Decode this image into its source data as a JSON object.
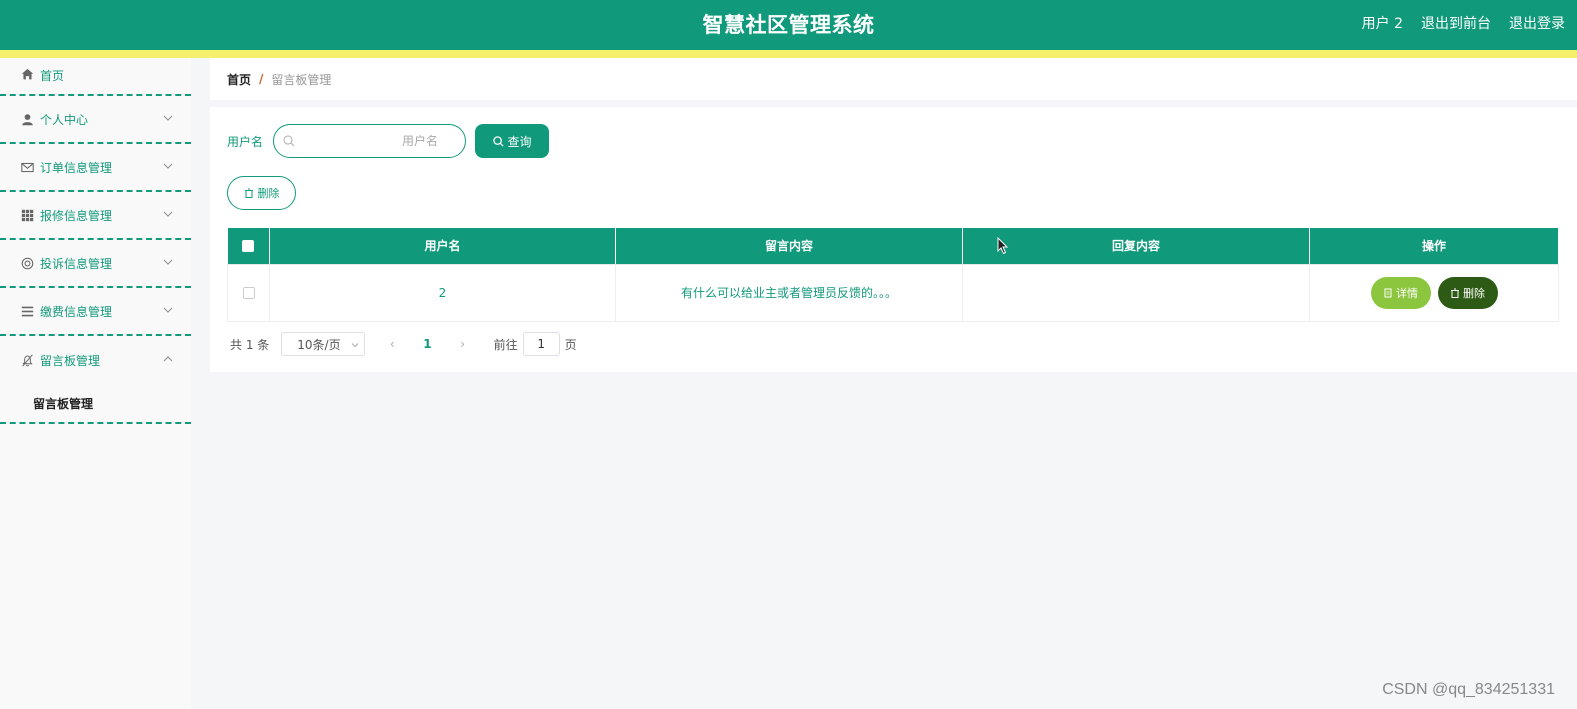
{
  "header": {
    "title": "智慧社区管理系统",
    "user": "用户 2",
    "to_front": "退出到前台",
    "logout": "退出登录",
    "bg_color": "#109a7b",
    "stripe_color": "#f4f06c"
  },
  "sidebar": {
    "items": [
      {
        "label": "首页",
        "icon": "home-icon"
      },
      {
        "label": "个人中心",
        "icon": "user-icon"
      },
      {
        "label": "订单信息管理",
        "icon": "mail-icon"
      },
      {
        "label": "报修信息管理",
        "icon": "grid-icon"
      },
      {
        "label": "投诉信息管理",
        "icon": "lifebuoy-icon"
      },
      {
        "label": "缴费信息管理",
        "icon": "menu-icon"
      },
      {
        "label": "留言板管理",
        "icon": "bell-off-icon"
      }
    ],
    "sub_item": "留言板管理"
  },
  "breadcrumb": {
    "home": "首页",
    "sep": "/",
    "current": "留言板管理"
  },
  "search": {
    "label": "用户名",
    "placeholder": "用户名",
    "query_button": "查询"
  },
  "actions": {
    "delete_button": "删除"
  },
  "table": {
    "headers": [
      "用户名",
      "留言内容",
      "回复内容",
      "操作"
    ],
    "rows": [
      {
        "username": "2",
        "content": "有什么可以给业主或者管理员反馈的。。。",
        "reply": "",
        "detail": "详情",
        "delete": "删除"
      }
    ]
  },
  "pagination": {
    "total": "共 1 条",
    "page_size": "10条/页",
    "prev": "‹",
    "current_page": "1",
    "next": "›",
    "goto_label": "前往",
    "goto_value": "1",
    "page_suffix": "页"
  },
  "watermark": "CSDN @qq_834251331"
}
